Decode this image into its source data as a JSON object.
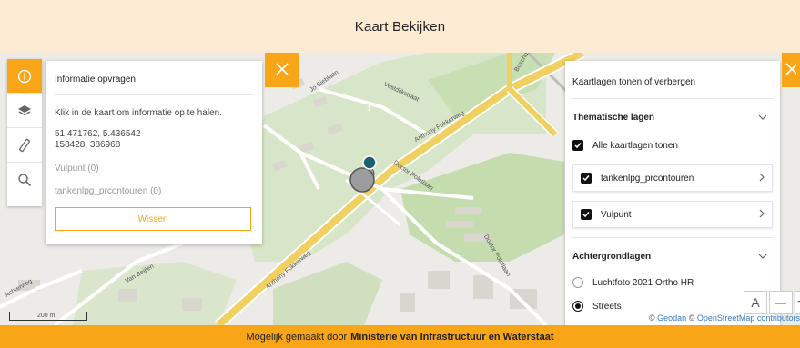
{
  "header": {
    "title": "Kaart Bekijken"
  },
  "toolbar": {
    "items": [
      {
        "icon": "info-icon",
        "active": true
      },
      {
        "icon": "layers-icon",
        "active": false
      },
      {
        "icon": "ruler-icon",
        "active": false
      },
      {
        "icon": "search-icon",
        "active": false
      }
    ]
  },
  "info_panel": {
    "title": "Informatie opvragen",
    "instruction": "Klik in de kaart om informatie op te halen.",
    "coord_latlon": "51.471762, 5.436542",
    "coord_rd": "158428, 386968",
    "result_vulpunt": "Vulpunt (0)",
    "result_contouren": "tankenlpg_prcontouren (0)",
    "clear_label": "Wissen"
  },
  "layers_panel": {
    "title": "Kaartlagen tonen of verbergen",
    "thematic_heading": "Thematische lagen",
    "show_all_label": "Alle kaartlagen tonen",
    "layers": [
      {
        "label": "tankenlpg_prcontouren",
        "checked": true
      },
      {
        "label": "Vulpunt",
        "checked": true
      }
    ],
    "background_heading": "Achtergrondlagen",
    "backgrounds": [
      {
        "label": "Luchtfoto 2021 Ortho HR",
        "selected": false
      },
      {
        "label": "Streets",
        "selected": true
      }
    ]
  },
  "map": {
    "marker_count": "1",
    "streets": [
      {
        "label": "Anthony Fokkerweg"
      },
      {
        "label": "Doctor Poletlaan"
      },
      {
        "label": "Boschdijk"
      },
      {
        "label": "Jo Sieblaan"
      },
      {
        "label": "Vestdijkstraat"
      },
      {
        "label": "Van Beijlen"
      },
      {
        "label": "Doctor Poletlaan"
      },
      {
        "label": "Anthony Fokkerweg"
      },
      {
        "label": "Achterweg"
      }
    ],
    "scale_label": "200 m",
    "zoom_a": "A",
    "zoom_out": "—",
    "zoom_in": "+"
  },
  "attribution": {
    "prefix": "©",
    "geodan": "Geodan",
    "sep": "©",
    "osm": "OpenStreetMap",
    "contrib": "contributors"
  },
  "footer": {
    "prefix": "Mogelijk gemaakt door",
    "org": "Ministerie van Infrastructuur en Waterstaat"
  },
  "colors": {
    "accent": "#f8a518",
    "header_bg": "#fbebd2",
    "road": "#f0d060",
    "green": "#c8e0b0",
    "marker": "#1f5f73"
  }
}
